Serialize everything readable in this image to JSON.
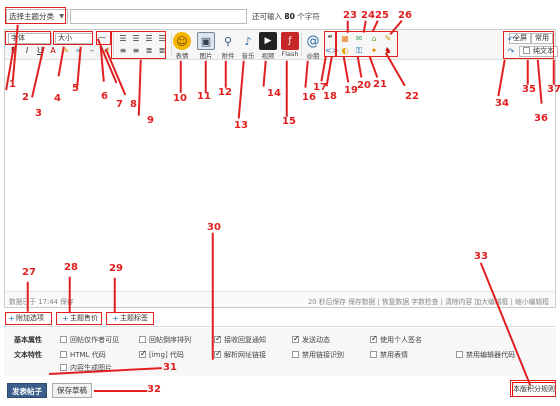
{
  "topbar": {
    "category_select": "选择主题分类",
    "char_hint_prefix": "还可输入",
    "char_hint_count": "80",
    "char_hint_suffix": "个字符"
  },
  "toolbar": {
    "font_family": "字体",
    "font_size": "大小",
    "format_icons": [
      "B",
      "I",
      "U",
      "A"
    ],
    "big_buttons": [
      {
        "name": "emoji",
        "label": "表情",
        "icon": "smile-icon"
      },
      {
        "name": "image",
        "label": "图片",
        "icon": "image-icon"
      },
      {
        "name": "attach",
        "label": "附件",
        "icon": "paperclip-icon"
      },
      {
        "name": "music",
        "label": "音乐",
        "icon": "music-icon"
      },
      {
        "name": "video",
        "label": "视频",
        "icon": "video-icon"
      },
      {
        "name": "flash",
        "label": "Flash",
        "icon": "flash-icon"
      },
      {
        "name": "mention",
        "label": "@朋",
        "icon": "at-icon"
      }
    ],
    "fullscreen": "全屏",
    "common": "常用",
    "plain_text": "纯文本"
  },
  "status": {
    "left": "数据已于 17:44 保存",
    "right": "20 秒后保存  保存数据 | 恢复数据   字数检查 | 清除内容   加大编辑框 | 缩小编辑框"
  },
  "tabs": [
    "附加选项",
    "主题售价",
    "主题标签"
  ],
  "options": {
    "basic_label": "基本属性",
    "text_label": "文本特性",
    "basic": [
      {
        "label": "回帖仅作者可见",
        "checked": false
      },
      {
        "label": "回帖倒序排列",
        "checked": false
      },
      {
        "label": "接收回复通知",
        "checked": true
      },
      {
        "label": "发送动态",
        "checked": true
      },
      {
        "label": "使用个人签名",
        "checked": true
      }
    ],
    "text": [
      {
        "label": "HTML 代码",
        "checked": false
      },
      {
        "label": "[img] 代码",
        "checked": true
      },
      {
        "label": "解析网址链接",
        "checked": true
      },
      {
        "label": "禁用链接识别",
        "checked": false
      },
      {
        "label": "禁用表情",
        "checked": false
      },
      {
        "label": "禁用编辑器代码",
        "checked": false
      },
      {
        "label": "内容生成图片",
        "checked": false
      }
    ]
  },
  "buttons": {
    "post": "发表帖子",
    "draft": "保存草稿",
    "rules": "本版积分规则"
  },
  "annotations": [
    "1",
    "2",
    "3",
    "4",
    "5",
    "6",
    "7",
    "8",
    "9",
    "10",
    "11",
    "12",
    "13",
    "14",
    "15",
    "16",
    "17",
    "18",
    "19",
    "20",
    "21",
    "22",
    "23",
    "24",
    "25",
    "26",
    "27",
    "28",
    "29",
    "30",
    "31",
    "32",
    "33",
    "34",
    "35",
    "36",
    "37"
  ],
  "colors": {
    "annotation": "#e02020",
    "post_button": "#3b5e8d"
  }
}
